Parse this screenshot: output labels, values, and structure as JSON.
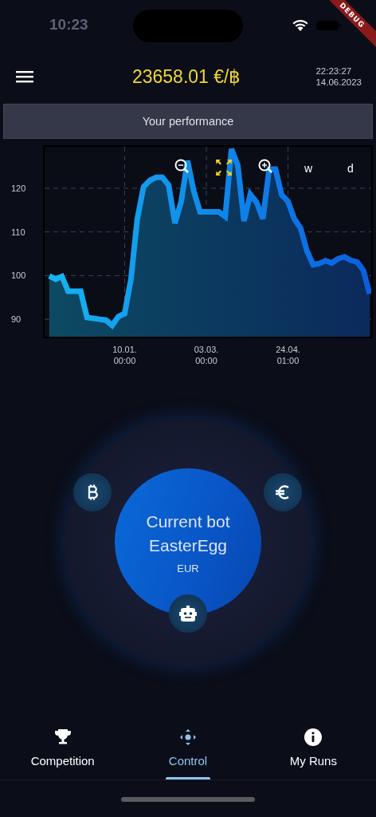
{
  "status_bar": {
    "time": "10:23"
  },
  "debug_banner": {
    "label": "DEBUG"
  },
  "header": {
    "price": "23658.01 €/฿",
    "time": "22:23:27",
    "date": "14.06.2023"
  },
  "performance_bar": {
    "title": "Your performance"
  },
  "chart": {
    "controls": [
      {
        "kind": "zoom_out"
      },
      {
        "kind": "fit"
      },
      {
        "kind": "zoom_in"
      },
      {
        "kind": "text",
        "label": "w"
      },
      {
        "kind": "text",
        "label": "d"
      }
    ],
    "chart_data": {
      "type": "area",
      "grid": true,
      "ylim": [
        86,
        129.5
      ],
      "yticks": [
        90,
        100,
        110,
        120
      ],
      "categories": [
        null,
        null,
        null,
        null,
        null,
        null,
        null,
        null,
        null,
        null,
        null,
        null,
        "10.01. 00:00",
        null,
        null,
        null,
        null,
        null,
        null,
        null,
        null,
        null,
        null,
        null,
        null,
        "03.03. 00:00",
        null,
        null,
        null,
        null,
        null,
        null,
        null,
        null,
        null,
        null,
        null,
        null,
        "24.04. 01:00",
        null,
        null,
        null,
        null,
        null,
        null,
        null,
        null,
        null,
        null,
        null,
        null,
        null
      ],
      "series": [
        {
          "color": "#16b4f2",
          "values": [
            99.9,
            99.2,
            99.8,
            96.4,
            96.4,
            96.4,
            90.4,
            90.2,
            90.0,
            89.8,
            88.6,
            90.6,
            91.3,
            99.2,
            112.9,
            120.3,
            121.8,
            122.5,
            122.5,
            120.7,
            112,
            117,
            126.3,
            119.3,
            114.6,
            114.6,
            114.6,
            114.6,
            113.5,
            129,
            125.3,
            112.5,
            118.6,
            116.8,
            113,
            124.4,
            124.4,
            118.5,
            117,
            113,
            110.9,
            105.7,
            102.5,
            102.8,
            103.4,
            102.9,
            103.9,
            104.3,
            103.5,
            103.1,
            101.2,
            95.8
          ]
        }
      ]
    }
  },
  "bot_control": {
    "title": "Current bot",
    "bot_name": "EasterEgg",
    "currency": "EUR",
    "actions": [
      {
        "kind": "bitcoin"
      },
      {
        "kind": "euro"
      },
      {
        "kind": "robot"
      }
    ]
  },
  "bottom_nav": [
    {
      "label": "Competition",
      "kind": "trophy",
      "selected": false
    },
    {
      "label": "Control",
      "kind": "move",
      "selected": true
    },
    {
      "label": "My Runs",
      "kind": "info",
      "selected": false
    }
  ]
}
